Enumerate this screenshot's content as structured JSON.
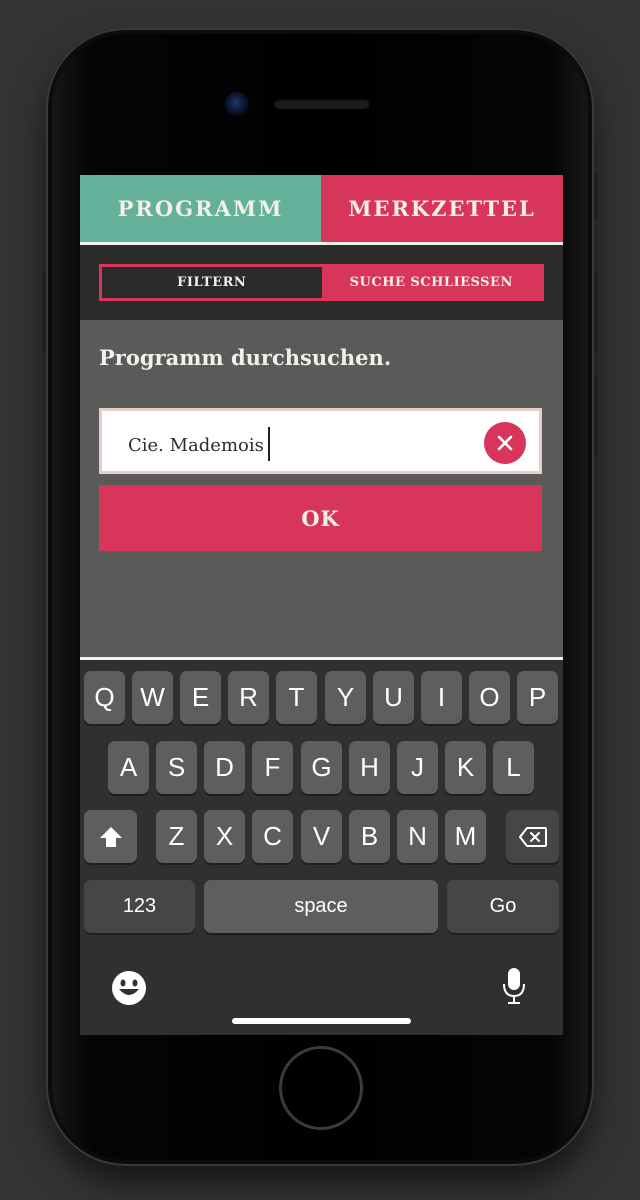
{
  "tabs": [
    {
      "label": "PROGRAMM",
      "color": "#64b09a"
    },
    {
      "label": "MERKZETTEL",
      "color": "#d8355b"
    }
  ],
  "filter_bar": {
    "filter_label": "FILTERN",
    "close_search_label": "SUCHE SCHLIESSEN"
  },
  "search": {
    "title": "Programm durchsuchen.",
    "value": "Cie. Mademois",
    "ok_label": "OK"
  },
  "keyboard": {
    "row1": [
      "Q",
      "W",
      "E",
      "R",
      "T",
      "Y",
      "U",
      "I",
      "O",
      "P"
    ],
    "row2": [
      "A",
      "S",
      "D",
      "F",
      "G",
      "H",
      "J",
      "K",
      "L"
    ],
    "row3": [
      "Z",
      "X",
      "C",
      "V",
      "B",
      "N",
      "M"
    ],
    "numbers_label": "123",
    "space_label": "space",
    "go_label": "Go",
    "shift_icon": "shift-icon",
    "backspace_icon": "backspace-icon",
    "emoji_icon": "emoji-icon",
    "mic_icon": "microphone-icon"
  },
  "colors": {
    "accent": "#d8355b",
    "secondary": "#64b09a",
    "background": "#5a5a5a",
    "keyboard_bg": "#303030"
  }
}
